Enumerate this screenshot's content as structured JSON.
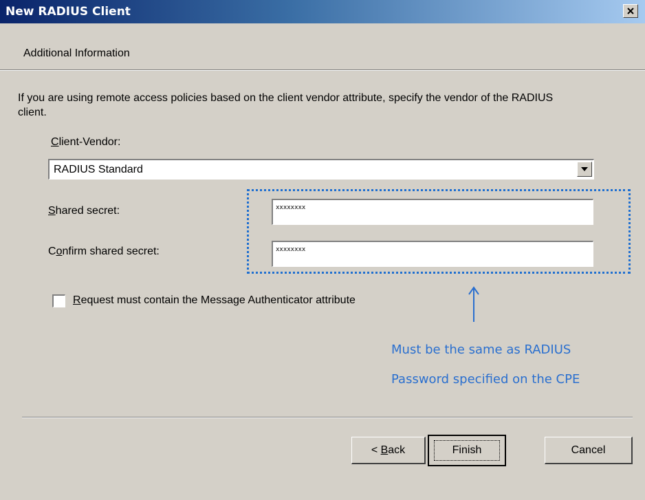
{
  "window": {
    "title": "New RADIUS Client",
    "close_glyph": "×"
  },
  "header": {
    "title": "Additional Information"
  },
  "description": "If you are using remote access policies based on the client vendor attribute, specify the vendor of the RADIUS client.",
  "client_vendor": {
    "label_first": "C",
    "label_rest": "lient-Vendor:",
    "selected": "RADIUS Standard"
  },
  "shared_secret": {
    "label_first": "S",
    "label_rest": "hared secret:",
    "value": "xxxxxxxx"
  },
  "confirm_secret": {
    "label_pre": "C",
    "label_ul": "o",
    "label_rest": "nfirm shared secret:",
    "value": "xxxxxxxx"
  },
  "message_auth": {
    "label_first": "R",
    "label_rest": "equest must contain the Message Authenticator attribute",
    "checked": false
  },
  "annotation": {
    "line1": "Must be the same as RADIUS",
    "line2": "Password specified on the CPE",
    "color": "#2a6fcf"
  },
  "buttons": {
    "back_pre": "< ",
    "back_ul": "B",
    "back_rest": "ack",
    "finish": "Finish",
    "cancel": "Cancel"
  }
}
